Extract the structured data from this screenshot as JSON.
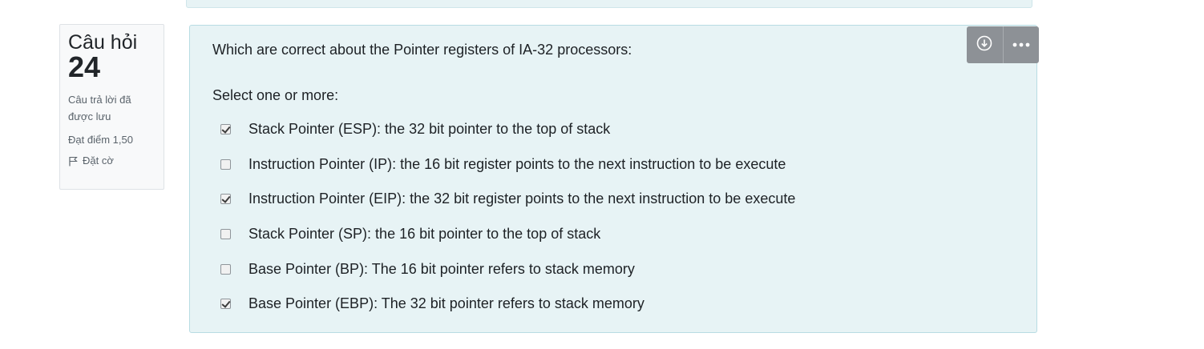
{
  "question_info": {
    "label": "Câu hỏi",
    "number": "24",
    "state": "Câu trả lời đã được lưu",
    "grade": "Đạt điểm 1,50",
    "flag_label": "Đặt cờ"
  },
  "question": {
    "text": "Which are correct about the Pointer registers of IA-32 processors:",
    "prompt": "Select one or more:",
    "answers": [
      {
        "label": "Stack Pointer (ESP): the 32 bit pointer to the top of stack",
        "checked": true
      },
      {
        "label": "Instruction Pointer (IP): the 16 bit register points to the next instruction to be execute",
        "checked": false
      },
      {
        "label": "Instruction Pointer (EIP): the 32 bit register points to the next instruction to be execute",
        "checked": true
      },
      {
        "label": "Stack Pointer (SP): the 16 bit pointer to the top of stack",
        "checked": false
      },
      {
        "label": "Base Pointer (BP): The 16 bit pointer refers to stack memory",
        "checked": false
      },
      {
        "label": "Base Pointer (EBP): The 32 bit pointer refers to stack memory",
        "checked": true
      }
    ]
  },
  "toolbar": {
    "icons": [
      "download-circle-icon",
      "more-dots-icon"
    ]
  },
  "colors": {
    "content_bg": "#e7f3f5",
    "content_border": "#b8dce3",
    "toolbar_bg": "#8d9196"
  }
}
